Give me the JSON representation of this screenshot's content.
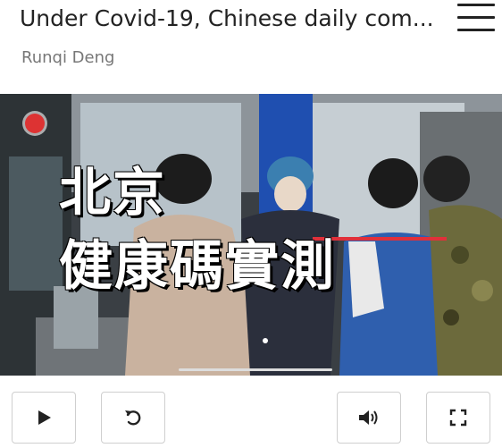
{
  "header": {
    "title": "Under Covid-19, Chinese daily com...",
    "author": "Runqi Deng",
    "menu_icon": "hamburger-menu-icon"
  },
  "video": {
    "overlay_line1": "北京",
    "overlay_line2": "健康碼實測",
    "live_icon": "live-record-icon"
  },
  "controls": {
    "play_icon": "play-icon",
    "replay_icon": "replay-icon",
    "volume_icon": "volume-icon",
    "fullscreen_icon": "fullscreen-icon"
  },
  "colors": {
    "title_text": "#222222",
    "author_text": "#777777",
    "accent_red": "#e0303a"
  }
}
